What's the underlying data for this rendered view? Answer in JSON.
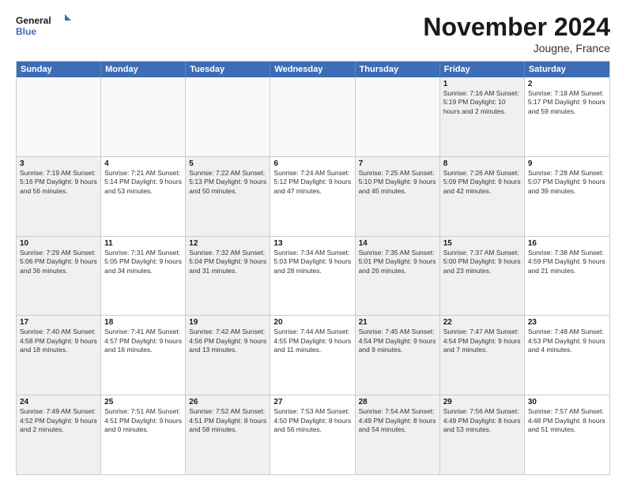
{
  "logo": {
    "line1": "General",
    "line2": "Blue"
  },
  "title": "November 2024",
  "location": "Jougne, France",
  "header_days": [
    "Sunday",
    "Monday",
    "Tuesday",
    "Wednesday",
    "Thursday",
    "Friday",
    "Saturday"
  ],
  "weeks": [
    [
      {
        "day": "",
        "text": "",
        "empty": true
      },
      {
        "day": "",
        "text": "",
        "empty": true
      },
      {
        "day": "",
        "text": "",
        "empty": true
      },
      {
        "day": "",
        "text": "",
        "empty": true
      },
      {
        "day": "",
        "text": "",
        "empty": true
      },
      {
        "day": "1",
        "text": "Sunrise: 7:16 AM\nSunset: 5:19 PM\nDaylight: 10 hours\nand 2 minutes.",
        "shaded": true
      },
      {
        "day": "2",
        "text": "Sunrise: 7:18 AM\nSunset: 5:17 PM\nDaylight: 9 hours\nand 59 minutes.",
        "shaded": false
      }
    ],
    [
      {
        "day": "3",
        "text": "Sunrise: 7:19 AM\nSunset: 5:16 PM\nDaylight: 9 hours\nand 56 minutes.",
        "shaded": true
      },
      {
        "day": "4",
        "text": "Sunrise: 7:21 AM\nSunset: 5:14 PM\nDaylight: 9 hours\nand 53 minutes.",
        "shaded": false
      },
      {
        "day": "5",
        "text": "Sunrise: 7:22 AM\nSunset: 5:13 PM\nDaylight: 9 hours\nand 50 minutes.",
        "shaded": true
      },
      {
        "day": "6",
        "text": "Sunrise: 7:24 AM\nSunset: 5:12 PM\nDaylight: 9 hours\nand 47 minutes.",
        "shaded": false
      },
      {
        "day": "7",
        "text": "Sunrise: 7:25 AM\nSunset: 5:10 PM\nDaylight: 9 hours\nand 45 minutes.",
        "shaded": true
      },
      {
        "day": "8",
        "text": "Sunrise: 7:26 AM\nSunset: 5:09 PM\nDaylight: 9 hours\nand 42 minutes.",
        "shaded": true
      },
      {
        "day": "9",
        "text": "Sunrise: 7:28 AM\nSunset: 5:07 PM\nDaylight: 9 hours\nand 39 minutes.",
        "shaded": false
      }
    ],
    [
      {
        "day": "10",
        "text": "Sunrise: 7:29 AM\nSunset: 5:06 PM\nDaylight: 9 hours\nand 36 minutes.",
        "shaded": true
      },
      {
        "day": "11",
        "text": "Sunrise: 7:31 AM\nSunset: 5:05 PM\nDaylight: 9 hours\nand 34 minutes.",
        "shaded": false
      },
      {
        "day": "12",
        "text": "Sunrise: 7:32 AM\nSunset: 5:04 PM\nDaylight: 9 hours\nand 31 minutes.",
        "shaded": true
      },
      {
        "day": "13",
        "text": "Sunrise: 7:34 AM\nSunset: 5:03 PM\nDaylight: 9 hours\nand 28 minutes.",
        "shaded": false
      },
      {
        "day": "14",
        "text": "Sunrise: 7:35 AM\nSunset: 5:01 PM\nDaylight: 9 hours\nand 26 minutes.",
        "shaded": true
      },
      {
        "day": "15",
        "text": "Sunrise: 7:37 AM\nSunset: 5:00 PM\nDaylight: 9 hours\nand 23 minutes.",
        "shaded": true
      },
      {
        "day": "16",
        "text": "Sunrise: 7:38 AM\nSunset: 4:59 PM\nDaylight: 9 hours\nand 21 minutes.",
        "shaded": false
      }
    ],
    [
      {
        "day": "17",
        "text": "Sunrise: 7:40 AM\nSunset: 4:58 PM\nDaylight: 9 hours\nand 18 minutes.",
        "shaded": true
      },
      {
        "day": "18",
        "text": "Sunrise: 7:41 AM\nSunset: 4:57 PM\nDaylight: 9 hours\nand 16 minutes.",
        "shaded": false
      },
      {
        "day": "19",
        "text": "Sunrise: 7:42 AM\nSunset: 4:56 PM\nDaylight: 9 hours\nand 13 minutes.",
        "shaded": true
      },
      {
        "day": "20",
        "text": "Sunrise: 7:44 AM\nSunset: 4:55 PM\nDaylight: 9 hours\nand 11 minutes.",
        "shaded": false
      },
      {
        "day": "21",
        "text": "Sunrise: 7:45 AM\nSunset: 4:54 PM\nDaylight: 9 hours\nand 9 minutes.",
        "shaded": true
      },
      {
        "day": "22",
        "text": "Sunrise: 7:47 AM\nSunset: 4:54 PM\nDaylight: 9 hours\nand 7 minutes.",
        "shaded": true
      },
      {
        "day": "23",
        "text": "Sunrise: 7:48 AM\nSunset: 4:53 PM\nDaylight: 9 hours\nand 4 minutes.",
        "shaded": false
      }
    ],
    [
      {
        "day": "24",
        "text": "Sunrise: 7:49 AM\nSunset: 4:52 PM\nDaylight: 9 hours\nand 2 minutes.",
        "shaded": true
      },
      {
        "day": "25",
        "text": "Sunrise: 7:51 AM\nSunset: 4:51 PM\nDaylight: 9 hours\nand 0 minutes.",
        "shaded": false
      },
      {
        "day": "26",
        "text": "Sunrise: 7:52 AM\nSunset: 4:51 PM\nDaylight: 8 hours\nand 58 minutes.",
        "shaded": true
      },
      {
        "day": "27",
        "text": "Sunrise: 7:53 AM\nSunset: 4:50 PM\nDaylight: 8 hours\nand 56 minutes.",
        "shaded": false
      },
      {
        "day": "28",
        "text": "Sunrise: 7:54 AM\nSunset: 4:49 PM\nDaylight: 8 hours\nand 54 minutes.",
        "shaded": true
      },
      {
        "day": "29",
        "text": "Sunrise: 7:56 AM\nSunset: 4:49 PM\nDaylight: 8 hours\nand 53 minutes.",
        "shaded": true
      },
      {
        "day": "30",
        "text": "Sunrise: 7:57 AM\nSunset: 4:48 PM\nDaylight: 8 hours\nand 51 minutes.",
        "shaded": false
      }
    ]
  ]
}
